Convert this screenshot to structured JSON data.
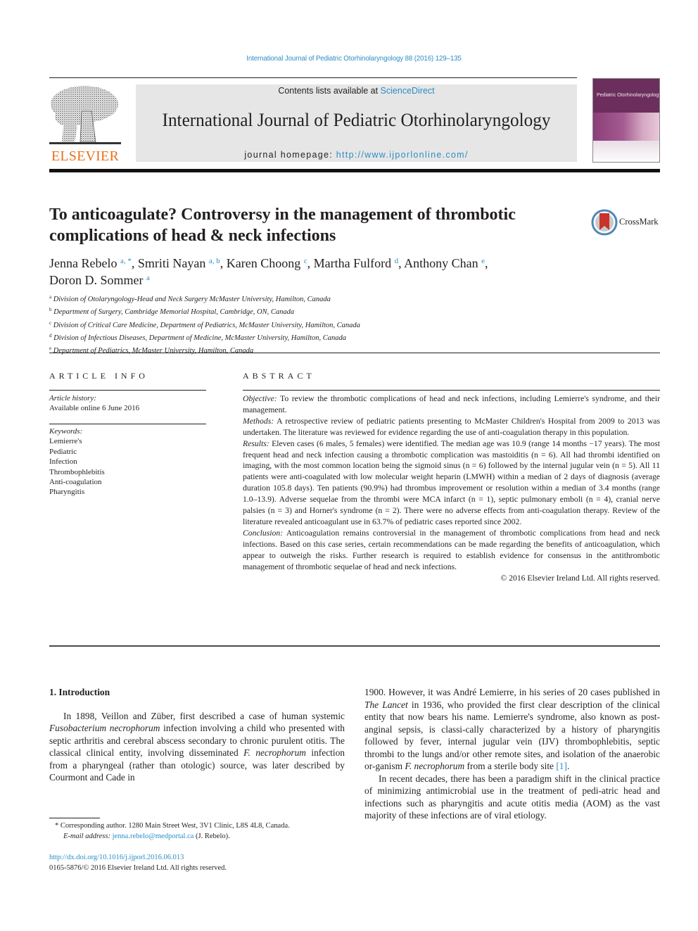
{
  "journal_ref": "International Journal of Pediatric Otorhinolaryngology 88 (2016) 129–135",
  "header": {
    "publisher_logo_text": "ELSEVIER",
    "contents_prefix": "Contents lists available at ",
    "contents_link": "ScienceDirect",
    "journal_name": "International Journal of Pediatric Otorhinolaryngology",
    "homepage_prefix": "journal homepage: ",
    "homepage_link": "http://www.ijporlonline.com/",
    "cover_title": "Pediatric Otorhinolaryngology",
    "colors": {
      "link": "#2a8ec4",
      "elsevier_orange": "#e9711c",
      "banner_bg": "#e6e6e6",
      "cover_purple": "#6c2e5c"
    }
  },
  "article": {
    "title_line1": "To anticoagulate? Controversy in the management of thrombotic",
    "title_line2": "complications of head & neck infections",
    "crossmark_label": "CrossMark",
    "authors": [
      {
        "name": "Jenna Rebelo",
        "sup": "a, *"
      },
      {
        "name": "Smriti Nayan",
        "sup": "a, b"
      },
      {
        "name": "Karen Choong",
        "sup": "c"
      },
      {
        "name": "Martha Fulford",
        "sup": "d"
      },
      {
        "name": "Anthony Chan",
        "sup": "e"
      },
      {
        "name": "Doron D. Sommer",
        "sup": "a"
      }
    ],
    "affiliations": [
      {
        "key": "a",
        "text": "Division of Otolaryngology-Head and Neck Surgery McMaster University, Hamilton, Canada"
      },
      {
        "key": "b",
        "text": "Department of Surgery, Cambridge Memorial Hospital, Cambridge, ON, Canada"
      },
      {
        "key": "c",
        "text": "Division of Critical Care Medicine, Department of Pediatrics, McMaster University, Hamilton, Canada"
      },
      {
        "key": "d",
        "text": "Division of Infectious Diseases, Department of Medicine, McMaster University, Hamilton, Canada"
      },
      {
        "key": "e",
        "text": "Department of Pediatrics, McMaster University, Hamilton, Canada"
      }
    ]
  },
  "article_info": {
    "heading": "ARTICLE INFO",
    "history_label": "Article history:",
    "history_value": "Available online 6 June 2016",
    "keywords_label": "Keywords:",
    "keywords": [
      "Lemierre's",
      "Pediatric",
      "Infection",
      "Thrombophlebitis",
      "Anti-coagulation",
      "Pharyngitis"
    ]
  },
  "abstract": {
    "heading": "ABSTRACT",
    "sections": [
      {
        "label": "Objective:",
        "text": " To review the thrombotic complications of head and neck infections, including Lemierre's syndrome, and their management."
      },
      {
        "label": "Methods:",
        "text": " A retrospective review of pediatric patients presenting to McMaster Children's Hospital from 2009 to 2013 was undertaken. The literature was reviewed for evidence regarding the use of anti-coagulation therapy in this population."
      },
      {
        "label": "Results:",
        "text": " Eleven cases (6 males, 5 females) were identified. The median age was 10.9 (range 14 months −17 years). The most frequent head and neck infection causing a thrombotic complication was mastoiditis (n = 6). All had thrombi identified on imaging, with the most common location being the sigmoid sinus (n = 6) followed by the internal jugular vein (n = 5). All 11 patients were anti-coagulated with low molecular weight heparin (LMWH) within a median of 2 days of diagnosis (average duration 105.8 days). Ten patients (90.9%) had thrombus improvement or resolution within a median of 3.4 months (range 1.0–13.9). Adverse sequelae from the thrombi were MCA infarct (n = 1), septic pulmonary emboli (n = 4), cranial nerve palsies (n = 3) and Horner's syndrome (n = 2). There were no adverse effects from anti-coagulation therapy. Review of the literature revealed anticoagulant use in 63.7% of pediatric cases reported since 2002."
      },
      {
        "label": "Conclusion:",
        "text": "  Anticoagulation remains controversial in the management of thrombotic complications from head and neck infections. Based on this case series, certain recommendations can be made regarding the benefits of anticoagulation, which appear to outweigh the risks. Further research is required to establish evidence for consensus in the antithrombotic management of thrombotic sequelae of head and neck infections."
      }
    ],
    "copyright": "© 2016 Elsevier Ireland Ltd. All rights reserved."
  },
  "body": {
    "section_heading": "1.  Introduction",
    "para1": {
      "t1": "In 1898, Veillon and Züber, first described a case of human systemic ",
      "i1": "Fusobacterium necrophorum",
      "t2": " infection involving a child who presented with septic arthritis and cerebral abscess secondary to chronic purulent otitis. The classical clinical entity, involving disseminated ",
      "i2": "F. necrophorum",
      "t3": " infection from a pharyngeal (rather than otologic) source, was later described by Courmont and Cade in 1900. However, it was André Lemierre, in his series of 20 cases published in ",
      "i3": "The Lancet",
      "t4": " in 1936, who provided the first clear description of the clinical entity that now bears his name. Lemierre's syndrome, also known as post-anginal sepsis, is classi-cally characterized by a history of pharyngitis followed by fever, internal jugular vein (IJV) thrombophlebitis, septic thrombi to the lungs and/or other remote sites, and isolation of the anaerobic or-ganism ",
      "i4": "F. necrophorum",
      "t5": " from a sterile body site ",
      "ref": "[1]",
      "t6": "."
    },
    "para2": "In recent decades, there has been a paradigm shift in the clinical practice of minimizing antimicrobial use in the treatment of pedi-atric head and infections such as pharyngitis and acute otitis media (AOM) as the vast majority of these infections are of viral etiology."
  },
  "footer": {
    "corresponding": "* Corresponding author. 1280 Main Street West, 3V1 Clinic, L8S 4L8, Canada.",
    "email_label": "E-mail address: ",
    "email": "jenna.rebelo@medportal.ca",
    "email_suffix": " (J. Rebelo).",
    "doi": "http://dx.doi.org/10.1016/j.ijporl.2016.06.013",
    "issn": "0165-5876/© 2016 Elsevier Ireland Ltd. All rights reserved."
  }
}
